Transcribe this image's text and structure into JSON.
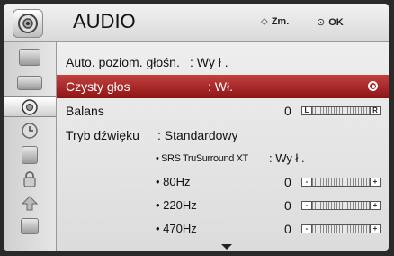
{
  "header": {
    "title": "AUDIO",
    "move_hint": "Zm.",
    "ok_hint": "OK",
    "icon": "speaker-icon"
  },
  "sidebar": {
    "items": [
      {
        "icon": "antenna-icon"
      },
      {
        "icon": "picture-icon"
      },
      {
        "icon": "audio-icon",
        "active": true
      },
      {
        "icon": "clock-icon"
      },
      {
        "icon": "options-icon"
      },
      {
        "icon": "lock-icon"
      },
      {
        "icon": "input-icon"
      },
      {
        "icon": "usb-icon"
      }
    ]
  },
  "menu": {
    "auto_volume": {
      "label": "Auto. poziom. głośn.",
      "value": ": Wy ł ."
    },
    "clear_voice": {
      "label": "Czysty głos",
      "value": ": Wł."
    },
    "balance": {
      "label": "Balans",
      "value": "0",
      "left": "L",
      "right": "R"
    },
    "sound_mode": {
      "label": "Tryb dźwięku",
      "value": ": Standardowy"
    },
    "srs": {
      "label": "• SRS TruSurround XT",
      "value": ": Wy ł ."
    },
    "eq": [
      {
        "label": "• 80Hz",
        "value": "0",
        "minus": "-",
        "plus": "+"
      },
      {
        "label": "• 220Hz",
        "value": "0",
        "minus": "-",
        "plus": "+"
      },
      {
        "label": "• 470Hz",
        "value": "0",
        "minus": "-",
        "plus": "+"
      }
    ]
  },
  "colors": {
    "selection": "#b32222",
    "background": "#e6e6e6"
  }
}
